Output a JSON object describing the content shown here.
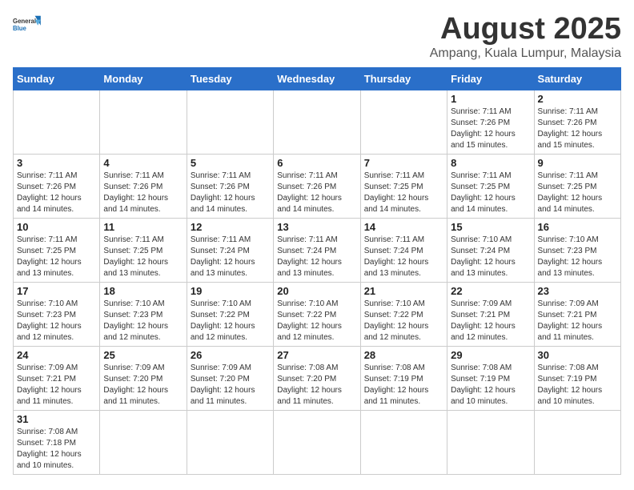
{
  "header": {
    "logo_general": "General",
    "logo_blue": "Blue",
    "title": "August 2025",
    "subtitle": "Ampang, Kuala Lumpur, Malaysia"
  },
  "weekdays": [
    "Sunday",
    "Monday",
    "Tuesday",
    "Wednesday",
    "Thursday",
    "Friday",
    "Saturday"
  ],
  "weeks": [
    [
      {
        "day": "",
        "info": ""
      },
      {
        "day": "",
        "info": ""
      },
      {
        "day": "",
        "info": ""
      },
      {
        "day": "",
        "info": ""
      },
      {
        "day": "",
        "info": ""
      },
      {
        "day": "1",
        "info": "Sunrise: 7:11 AM\nSunset: 7:26 PM\nDaylight: 12 hours\nand 15 minutes."
      },
      {
        "day": "2",
        "info": "Sunrise: 7:11 AM\nSunset: 7:26 PM\nDaylight: 12 hours\nand 15 minutes."
      }
    ],
    [
      {
        "day": "3",
        "info": "Sunrise: 7:11 AM\nSunset: 7:26 PM\nDaylight: 12 hours\nand 14 minutes."
      },
      {
        "day": "4",
        "info": "Sunrise: 7:11 AM\nSunset: 7:26 PM\nDaylight: 12 hours\nand 14 minutes."
      },
      {
        "day": "5",
        "info": "Sunrise: 7:11 AM\nSunset: 7:26 PM\nDaylight: 12 hours\nand 14 minutes."
      },
      {
        "day": "6",
        "info": "Sunrise: 7:11 AM\nSunset: 7:26 PM\nDaylight: 12 hours\nand 14 minutes."
      },
      {
        "day": "7",
        "info": "Sunrise: 7:11 AM\nSunset: 7:25 PM\nDaylight: 12 hours\nand 14 minutes."
      },
      {
        "day": "8",
        "info": "Sunrise: 7:11 AM\nSunset: 7:25 PM\nDaylight: 12 hours\nand 14 minutes."
      },
      {
        "day": "9",
        "info": "Sunrise: 7:11 AM\nSunset: 7:25 PM\nDaylight: 12 hours\nand 14 minutes."
      }
    ],
    [
      {
        "day": "10",
        "info": "Sunrise: 7:11 AM\nSunset: 7:25 PM\nDaylight: 12 hours\nand 13 minutes."
      },
      {
        "day": "11",
        "info": "Sunrise: 7:11 AM\nSunset: 7:25 PM\nDaylight: 12 hours\nand 13 minutes."
      },
      {
        "day": "12",
        "info": "Sunrise: 7:11 AM\nSunset: 7:24 PM\nDaylight: 12 hours\nand 13 minutes."
      },
      {
        "day": "13",
        "info": "Sunrise: 7:11 AM\nSunset: 7:24 PM\nDaylight: 12 hours\nand 13 minutes."
      },
      {
        "day": "14",
        "info": "Sunrise: 7:11 AM\nSunset: 7:24 PM\nDaylight: 12 hours\nand 13 minutes."
      },
      {
        "day": "15",
        "info": "Sunrise: 7:10 AM\nSunset: 7:24 PM\nDaylight: 12 hours\nand 13 minutes."
      },
      {
        "day": "16",
        "info": "Sunrise: 7:10 AM\nSunset: 7:23 PM\nDaylight: 12 hours\nand 13 minutes."
      }
    ],
    [
      {
        "day": "17",
        "info": "Sunrise: 7:10 AM\nSunset: 7:23 PM\nDaylight: 12 hours\nand 12 minutes."
      },
      {
        "day": "18",
        "info": "Sunrise: 7:10 AM\nSunset: 7:23 PM\nDaylight: 12 hours\nand 12 minutes."
      },
      {
        "day": "19",
        "info": "Sunrise: 7:10 AM\nSunset: 7:22 PM\nDaylight: 12 hours\nand 12 minutes."
      },
      {
        "day": "20",
        "info": "Sunrise: 7:10 AM\nSunset: 7:22 PM\nDaylight: 12 hours\nand 12 minutes."
      },
      {
        "day": "21",
        "info": "Sunrise: 7:10 AM\nSunset: 7:22 PM\nDaylight: 12 hours\nand 12 minutes."
      },
      {
        "day": "22",
        "info": "Sunrise: 7:09 AM\nSunset: 7:21 PM\nDaylight: 12 hours\nand 12 minutes."
      },
      {
        "day": "23",
        "info": "Sunrise: 7:09 AM\nSunset: 7:21 PM\nDaylight: 12 hours\nand 11 minutes."
      }
    ],
    [
      {
        "day": "24",
        "info": "Sunrise: 7:09 AM\nSunset: 7:21 PM\nDaylight: 12 hours\nand 11 minutes."
      },
      {
        "day": "25",
        "info": "Sunrise: 7:09 AM\nSunset: 7:20 PM\nDaylight: 12 hours\nand 11 minutes."
      },
      {
        "day": "26",
        "info": "Sunrise: 7:09 AM\nSunset: 7:20 PM\nDaylight: 12 hours\nand 11 minutes."
      },
      {
        "day": "27",
        "info": "Sunrise: 7:08 AM\nSunset: 7:20 PM\nDaylight: 12 hours\nand 11 minutes."
      },
      {
        "day": "28",
        "info": "Sunrise: 7:08 AM\nSunset: 7:19 PM\nDaylight: 12 hours\nand 11 minutes."
      },
      {
        "day": "29",
        "info": "Sunrise: 7:08 AM\nSunset: 7:19 PM\nDaylight: 12 hours\nand 10 minutes."
      },
      {
        "day": "30",
        "info": "Sunrise: 7:08 AM\nSunset: 7:19 PM\nDaylight: 12 hours\nand 10 minutes."
      }
    ],
    [
      {
        "day": "31",
        "info": "Sunrise: 7:08 AM\nSunset: 7:18 PM\nDaylight: 12 hours\nand 10 minutes."
      },
      {
        "day": "",
        "info": ""
      },
      {
        "day": "",
        "info": ""
      },
      {
        "day": "",
        "info": ""
      },
      {
        "day": "",
        "info": ""
      },
      {
        "day": "",
        "info": ""
      },
      {
        "day": "",
        "info": ""
      }
    ]
  ]
}
